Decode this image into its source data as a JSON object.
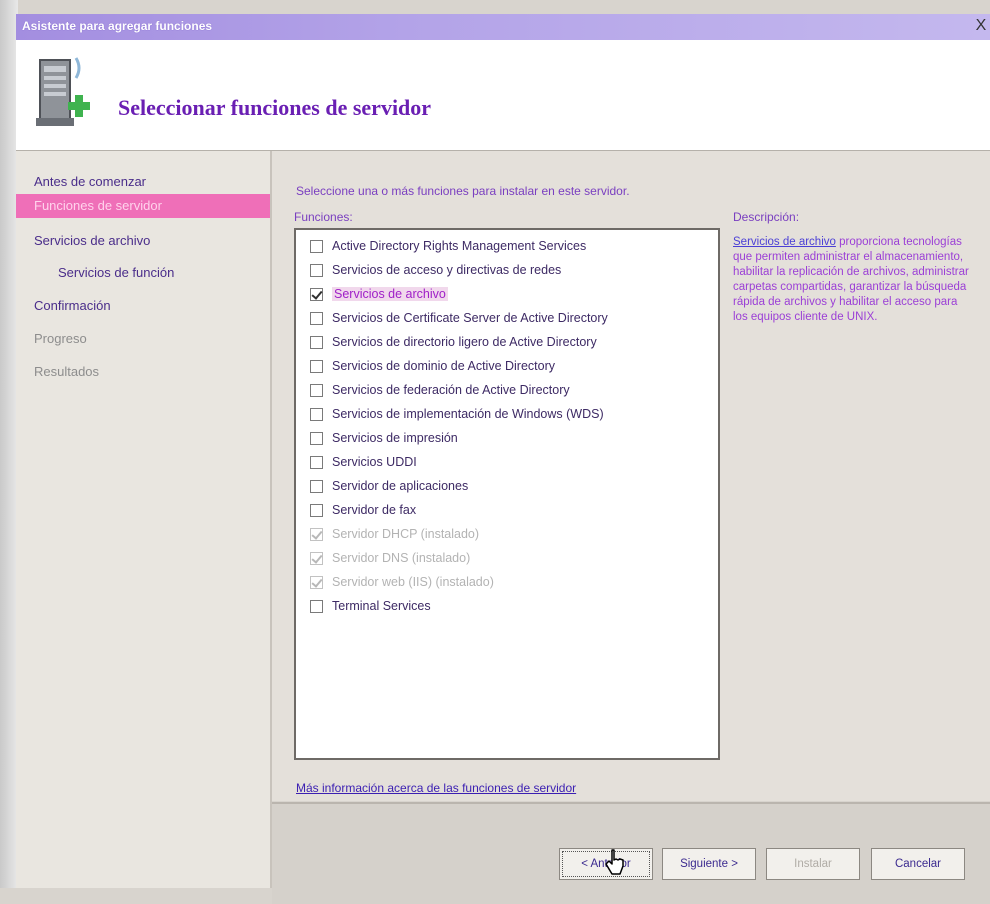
{
  "window": {
    "title": "Asistente para agregar funciones",
    "close_label": "X"
  },
  "header": {
    "title": "Seleccionar funciones de servidor",
    "icon": "server-add-icon"
  },
  "sidebar": {
    "items": [
      {
        "label": "Antes de comenzar",
        "state": "normal"
      },
      {
        "label": "Funciones de servidor",
        "state": "active"
      },
      {
        "label": "Servicios de archivo",
        "state": "normal"
      },
      {
        "label": "Servicios de función",
        "state": "normal"
      },
      {
        "label": "Confirmación",
        "state": "normal"
      },
      {
        "label": "Progreso",
        "state": "muted"
      },
      {
        "label": "Resultados",
        "state": "muted"
      }
    ]
  },
  "main": {
    "instruction": "Seleccione una o más funciones para instalar en este servidor.",
    "roles_label": "Funciones:",
    "description_label": "Descripción:",
    "roles": [
      {
        "label": "Active Directory Rights Management Services",
        "checked": false,
        "installed": false
      },
      {
        "label": "Servicios de acceso y directivas de redes",
        "checked": false,
        "installed": false
      },
      {
        "label": "Servicios de archivo",
        "checked": true,
        "installed": false,
        "selected": true
      },
      {
        "label": "Servicios de Certificate Server de Active Directory",
        "checked": false,
        "installed": false
      },
      {
        "label": "Servicios de directorio ligero de Active Directory",
        "checked": false,
        "installed": false
      },
      {
        "label": "Servicios de dominio de Active Directory",
        "checked": false,
        "installed": false
      },
      {
        "label": "Servicios de federación de Active Directory",
        "checked": false,
        "installed": false
      },
      {
        "label": "Servicios de implementación de Windows (WDS)",
        "checked": false,
        "installed": false
      },
      {
        "label": "Servicios de impresión",
        "checked": false,
        "installed": false
      },
      {
        "label": "Servicios UDDI",
        "checked": false,
        "installed": false
      },
      {
        "label": "Servidor de aplicaciones",
        "checked": false,
        "installed": false
      },
      {
        "label": "Servidor de fax",
        "checked": false,
        "installed": false
      },
      {
        "label": "Servidor DHCP (instalado)",
        "checked": true,
        "installed": true
      },
      {
        "label": "Servidor DNS (instalado)",
        "checked": true,
        "installed": true
      },
      {
        "label": "Servidor web (IIS) (instalado)",
        "checked": true,
        "installed": true
      },
      {
        "label": "Terminal Services",
        "checked": false,
        "installed": false
      }
    ],
    "description_link": "Servicios de archivo",
    "description_text": " proporciona tecnologías que permiten administrar el almacenamiento, habilitar la replicación de archivos, administrar carpetas compartidas, garantizar la búsqueda rápida de archivos y habilitar el acceso para los equipos cliente de UNIX.",
    "more_info_link": "Más información acerca de las funciones de servidor"
  },
  "footer": {
    "back_label": "< Anterior",
    "next_label": "Siguiente >",
    "install_label": "Instalar",
    "cancel_label": "Cancelar"
  },
  "colors": {
    "active_nav": "#ef6fb8",
    "title_purple": "#6a1fb3",
    "link_blue": "#3b1fb2"
  }
}
